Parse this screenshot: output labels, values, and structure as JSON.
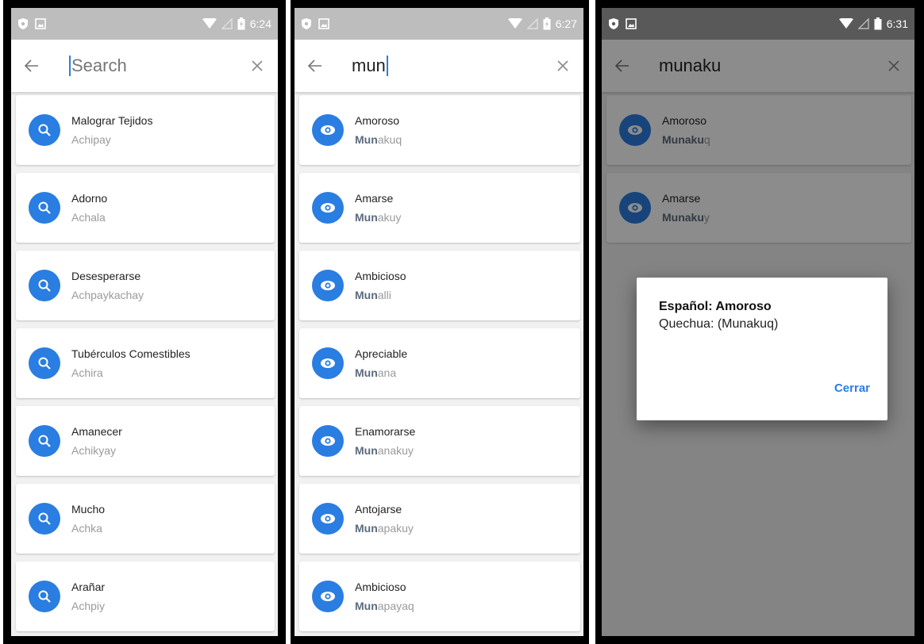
{
  "colors": {
    "accent": "#2a7de1",
    "statusbar": "#bdbdbd",
    "overlay": "rgba(0,0,0,0.45)"
  },
  "screens": [
    {
      "status": {
        "time": "6:24"
      },
      "search": {
        "placeholder": "Search",
        "query": ""
      },
      "items": [
        {
          "title": "Malograr Tejidos",
          "subtitle": "Achipay",
          "icon": "search-icon"
        },
        {
          "title": "Adorno",
          "subtitle": "Achala",
          "icon": "search-icon"
        },
        {
          "title": "Desesperarse",
          "subtitle": "Achpaykachay",
          "icon": "search-icon"
        },
        {
          "title": "Tubérculos Comestibles",
          "subtitle": "Achira",
          "icon": "search-icon"
        },
        {
          "title": "Amanecer",
          "subtitle": "Achikyay",
          "icon": "search-icon"
        },
        {
          "title": "Mucho",
          "subtitle": "Achka",
          "icon": "search-icon"
        },
        {
          "title": "Arañar",
          "subtitle": "Achpiy",
          "icon": "search-icon"
        }
      ]
    },
    {
      "status": {
        "time": "6:27"
      },
      "search": {
        "placeholder": "",
        "query": "mun"
      },
      "items": [
        {
          "title": "Amoroso",
          "highlight": "Mun",
          "rest": "akuq",
          "icon": "eye-icon"
        },
        {
          "title": "Amarse",
          "highlight": "Mun",
          "rest": "akuy",
          "icon": "eye-icon"
        },
        {
          "title": "Ambicioso",
          "highlight": "Mun",
          "rest": "alli",
          "icon": "eye-icon"
        },
        {
          "title": "Apreciable",
          "highlight": "Mun",
          "rest": "ana",
          "icon": "eye-icon"
        },
        {
          "title": "Enamorarse",
          "highlight": "Mun",
          "rest": "anakuy",
          "icon": "eye-icon"
        },
        {
          "title": "Antojarse",
          "highlight": "Mun",
          "rest": "apakuy",
          "icon": "eye-icon"
        },
        {
          "title": "Ambicioso",
          "highlight": "Mun",
          "rest": "apayaq",
          "icon": "eye-icon"
        }
      ]
    },
    {
      "status": {
        "time": "6:31"
      },
      "search": {
        "placeholder": "",
        "query": "munaku"
      },
      "items": [
        {
          "title": "Amoroso",
          "highlight": "Munaku",
          "rest": "q",
          "icon": "eye-icon"
        },
        {
          "title": "Amarse",
          "highlight": "Munaku",
          "rest": "y",
          "icon": "eye-icon"
        }
      ],
      "dialog": {
        "title": "Español: Amoroso",
        "text": "Quechua: (Munakuq)",
        "button": "Cerrar"
      }
    }
  ]
}
